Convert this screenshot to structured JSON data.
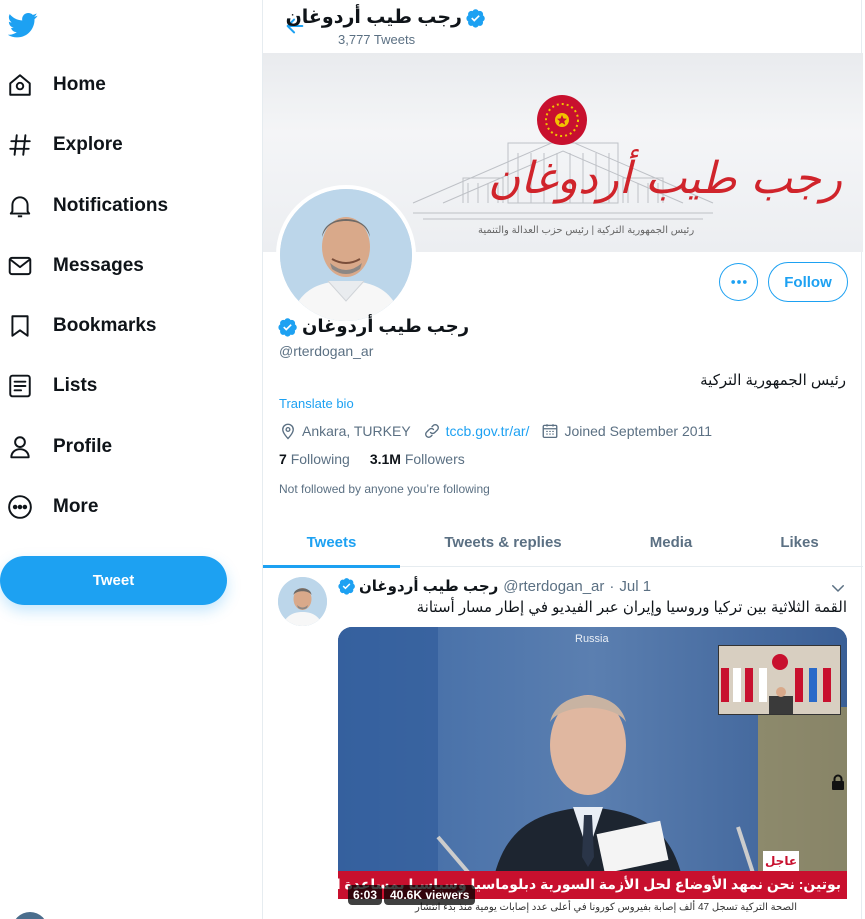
{
  "icons": {
    "logo": "twitter-bird-icon",
    "home": "home-icon",
    "explore": "hashtag-icon",
    "notifications": "bell-icon",
    "messages": "envelope-icon",
    "bookmarks": "bookmark-icon",
    "lists": "list-icon",
    "profile": "person-icon",
    "more": "more-circle-icon"
  },
  "colors": {
    "accent": "#1da1f2",
    "text": "#0f1419",
    "muted": "#5b7083",
    "border": "#e6ecf0",
    "news_red": "#c8102e"
  },
  "sidebar": {
    "items": [
      {
        "label": "Home"
      },
      {
        "label": "Explore"
      },
      {
        "label": "Notifications"
      },
      {
        "label": "Messages"
      },
      {
        "label": "Bookmarks"
      },
      {
        "label": "Lists"
      },
      {
        "label": "Profile"
      },
      {
        "label": "More"
      }
    ],
    "tweet_button": "Tweet"
  },
  "header": {
    "name": "رجب طيب أردوغان",
    "tweet_count": "3,777 Tweets"
  },
  "banner": {
    "title": "رجب طيب أردوغان",
    "subtitle": "رئيس الجمهورية التركية | رئيس حزب العدالة والتنمية"
  },
  "profile": {
    "name": "رجب طيب أردوغان",
    "handle": "@rterdogan_ar",
    "bio": "رئيس الجمهورية التركية",
    "translate": "Translate bio",
    "location": "Ankara, TURKEY",
    "website": "tccb.gov.tr/ar/",
    "joined": "Joined September 2011",
    "following_count": "7",
    "following_label": "Following",
    "followers_count": "3.1M",
    "followers_label": "Followers",
    "not_followed": "Not followed by anyone you’re following",
    "follow_button": "Follow"
  },
  "tabs": [
    {
      "label": "Tweets",
      "active": true
    },
    {
      "label": "Tweets & replies",
      "active": false
    },
    {
      "label": "Media",
      "active": false
    },
    {
      "label": "Likes",
      "active": false
    }
  ],
  "tweet": {
    "name": "رجب طيب أردوغان",
    "handle": "@rterdogan_ar",
    "separator": "·",
    "date": "Jul 1",
    "text": "القمة الثلاثية بين تركيا وروسيا وإيران عبر الفيديو في إطار مسار أستانة",
    "media": {
      "location_label": "Russia",
      "breaking_label": "عاجل",
      "headline": "بوتين: نحن نمهد الأوضاع لحل الأزمة السورية دبلوماسيا وسياسيا بمساعدة الأمم المتحدة",
      "ticker": "الصحة التركية تسجل 47 ألف إصابة بفيروس كورونا في أعلى عدد إصابات يومية منذ بدء انتشار",
      "duration": "6:03",
      "viewers": "40.6K viewers"
    }
  }
}
